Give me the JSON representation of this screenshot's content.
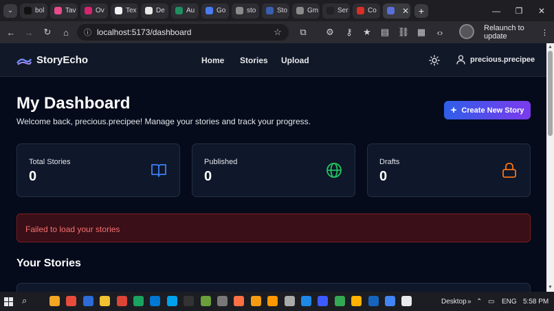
{
  "browser": {
    "tabs": [
      {
        "label": "bol",
        "color": "#111111"
      },
      {
        "label": "Tav",
        "color": "#e84a8a"
      },
      {
        "label": "Ov",
        "color": "#d6246e"
      },
      {
        "label": "Tex",
        "color": "#f2f2f2"
      },
      {
        "label": "De",
        "color": "#e8e8e8"
      },
      {
        "label": "Au",
        "color": "#1f8f5f"
      },
      {
        "label": "Go",
        "color": "#4a7cf0"
      },
      {
        "label": "sto",
        "color": "#8a8a8a"
      },
      {
        "label": "Sto",
        "color": "#3a5fb0"
      },
      {
        "label": "Gm",
        "color": "#8a8a8a"
      },
      {
        "label": "Ser",
        "color": "#222222"
      },
      {
        "label": "Co",
        "color": "#d93025"
      }
    ],
    "address": "localhost:5173/dashboard",
    "relaunch_label": "Relaunch to update"
  },
  "navbar": {
    "brand": "StoryEcho",
    "links": [
      "Home",
      "Stories",
      "Upload"
    ],
    "username": "precious.precipee"
  },
  "dashboard": {
    "title": "My Dashboard",
    "subtitle": "Welcome back, precious.precipee! Manage your stories and track your progress.",
    "create_button": "Create New Story",
    "stats": [
      {
        "label": "Total Stories",
        "value": "0",
        "icon": "book-icon",
        "color": "#3b82f6"
      },
      {
        "label": "Published",
        "value": "0",
        "icon": "globe-icon",
        "color": "#22c55e"
      },
      {
        "label": "Drafts",
        "value": "0",
        "icon": "lock-icon",
        "color": "#f97316"
      }
    ],
    "error": "Failed to load your stories",
    "section_title": "Your Stories"
  },
  "taskbar": {
    "desktop_label": "Desktop",
    "language": "ENG",
    "time": "5:58 PM"
  }
}
